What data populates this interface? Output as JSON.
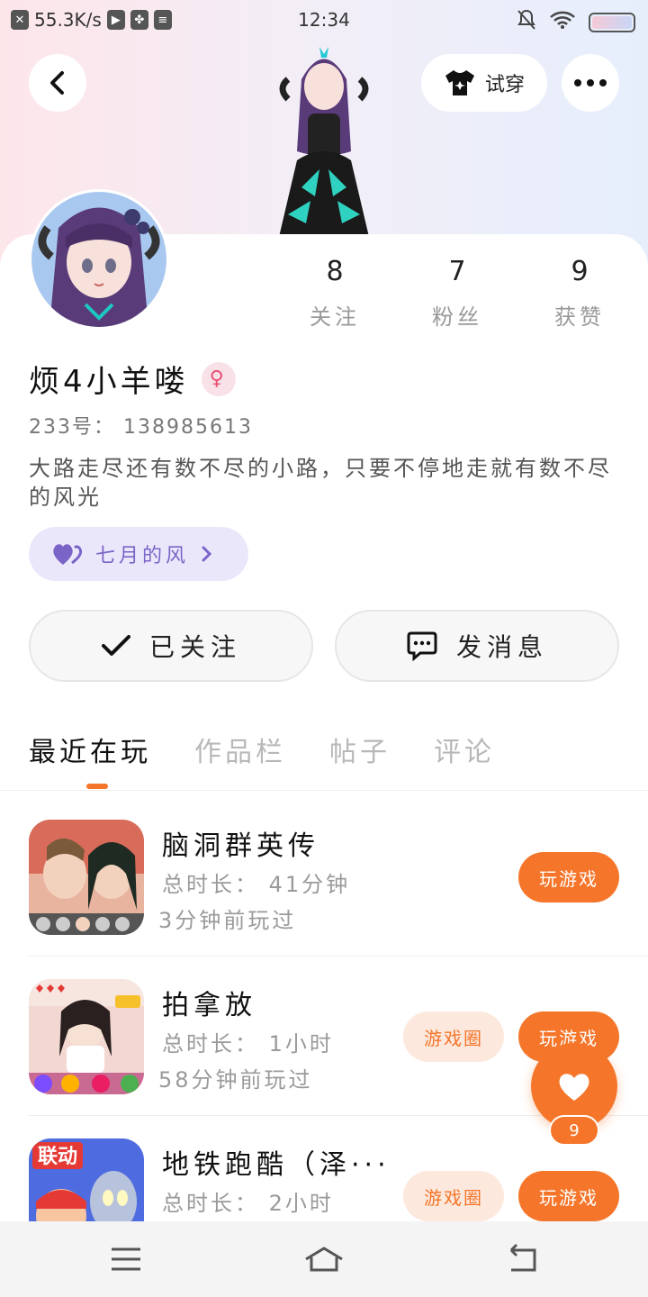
{
  "status_bar": {
    "net_speed": "55.3K/s",
    "time": "12:34"
  },
  "header": {
    "try_on_label": "试穿"
  },
  "profile": {
    "name": "烦4小羊喽",
    "gender_symbol": "♀",
    "uid": "233号： 138985613",
    "bio": "大路走尽还有数不尽的小路，只要不停地走就有数不尽的风光",
    "tag_label": "七月的风",
    "stats": [
      {
        "num": "8",
        "label": "关注"
      },
      {
        "num": "7",
        "label": "粉丝"
      },
      {
        "num": "9",
        "label": "获赞"
      }
    ],
    "follow_label": "已关注",
    "message_label": "发消息"
  },
  "tabs": [
    "最近在玩",
    "作品栏",
    "帖子",
    "评论"
  ],
  "games": [
    {
      "name": "脑洞群英传",
      "duration": "总时长： 41分钟",
      "last_played": "3分钟前玩过",
      "play_label": "玩游戏"
    },
    {
      "name": "拍拿放",
      "duration": "总时长： 1小时",
      "last_played": "58分钟前玩过",
      "circle_label": "游戏圈",
      "play_label": "玩游戏"
    },
    {
      "name": "地铁跑酷（泽···",
      "duration": "总时长： 2小时",
      "circle_label": "游戏圈",
      "play_label": "玩游戏",
      "icon_text": "联动"
    }
  ],
  "fab": {
    "count": "9"
  },
  "colors": {
    "accent": "#f5762a",
    "tag_bg": "#ebe7fb",
    "tag_text": "#7b64c8"
  }
}
